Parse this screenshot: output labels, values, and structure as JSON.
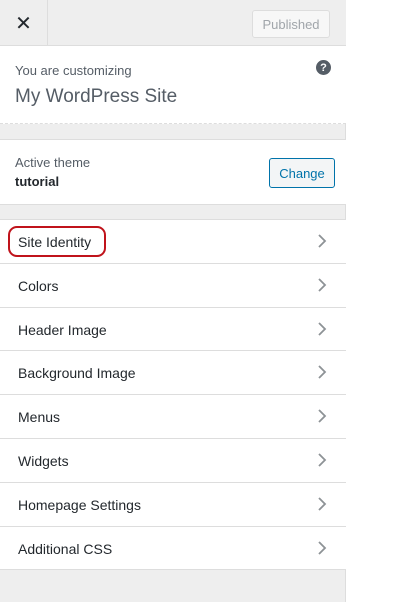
{
  "topbar": {
    "close_symbol": "✕",
    "published_label": "Published"
  },
  "info": {
    "label": "You are customizing",
    "site_title": "My WordPress Site",
    "help_symbol": "?"
  },
  "theme": {
    "label": "Active theme",
    "name": "tutorial",
    "change_label": "Change"
  },
  "sections": [
    {
      "label": "Site Identity",
      "highlighted": true
    },
    {
      "label": "Colors"
    },
    {
      "label": "Header Image"
    },
    {
      "label": "Background Image"
    },
    {
      "label": "Menus"
    },
    {
      "label": "Widgets"
    },
    {
      "label": "Homepage Settings"
    },
    {
      "label": "Additional CSS"
    }
  ],
  "colors": {
    "accent": "#0073aa",
    "highlight": "#c0131b"
  },
  "icons": {
    "close": "close-icon",
    "help": "help-icon",
    "chevron": "chevron-right-icon"
  }
}
